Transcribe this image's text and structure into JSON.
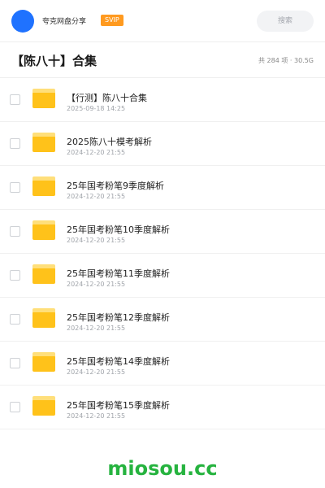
{
  "header": {
    "username": "夸克网盘分享",
    "badge": "SVIP",
    "search_placeholder": "搜索"
  },
  "folder": {
    "title": "【陈八十】合集",
    "meta": "共 284 项 · 30.5G"
  },
  "files": [
    {
      "name": "【行测】陈八十合集",
      "date": "2025-09-18 14:25"
    },
    {
      "name": "2025陈八十模考解析",
      "date": "2024-12-20 21:55"
    },
    {
      "name": "25年国考粉笔9季度解析",
      "date": "2024-12-20 21:55"
    },
    {
      "name": "25年国考粉笔10季度解析",
      "date": "2024-12-20 21:55"
    },
    {
      "name": "25年国考粉笔11季度解析",
      "date": "2024-12-20 21:55"
    },
    {
      "name": "25年国考粉笔12季度解析",
      "date": "2024-12-20 21:55"
    },
    {
      "name": "25年国考粉笔14季度解析",
      "date": "2024-12-20 21:55"
    },
    {
      "name": "25年国考粉笔15季度解析",
      "date": "2024-12-20 21:55"
    }
  ],
  "watermark": "miosou.cc",
  "colors": {
    "avatar": "#1f72ff",
    "badge": "#ff9a1f",
    "folder_icon": "#ffc21a",
    "watermark": "#26b33f"
  }
}
